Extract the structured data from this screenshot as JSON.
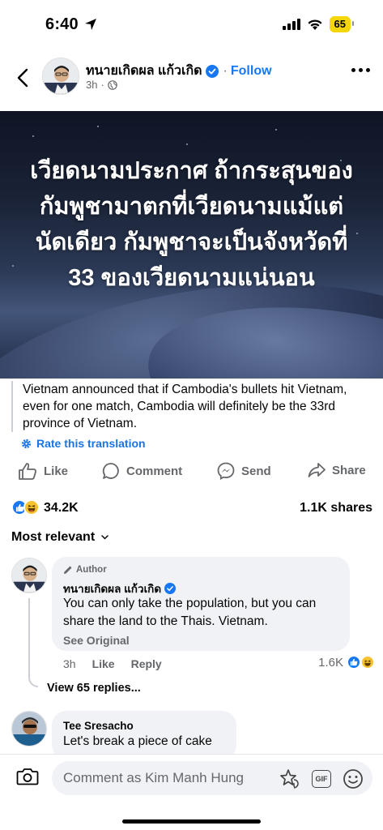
{
  "status_bar": {
    "time": "6:40",
    "battery": "65",
    "battery_color": "#f5d50b"
  },
  "post": {
    "author": "ทนายเกิดผล แก้วเกิด",
    "follow_label": "Follow",
    "time": "3h",
    "image_text": "เวียดนามประกาศ ถ้ากระสุนของกัมพูชามาตกที่เวียดนามแม้แต่นัดเดียว กัมพูชาจะเป็นจังหวัดที่ 33 ของเวียดนามแน่นอน",
    "translation": "Vietnam announced that if Cambodia's bullets hit Vietnam, even for one match, Cambodia will definitely be the 33rd province of Vietnam.",
    "rate_translation": "Rate this translation"
  },
  "actions": {
    "like": "Like",
    "comment": "Comment",
    "send": "Send",
    "share": "Share"
  },
  "counts": {
    "reactions": "34.2K",
    "shares": "1.1K shares"
  },
  "sort_label": "Most relevant",
  "comments": [
    {
      "badge": "Author",
      "name": "ทนายเกิดผล แก้วเกิด",
      "text": "You can only take the population, but you can share the land to the Thais. Vietnam.",
      "see_original": "See Original",
      "time": "3h",
      "like_label": "Like",
      "reply_label": "Reply",
      "reaction_count": "1.6K",
      "view_replies": "View 65 replies..."
    },
    {
      "name": "Tee Sresacho",
      "text": "Let's break a piece of cake"
    }
  ],
  "comment_bar": {
    "placeholder": "Comment as Kim Manh Hung",
    "gif_label": "GIF"
  },
  "colors": {
    "accent": "#1877f2",
    "link": "#1b74e4",
    "secondary_text": "#65676b",
    "bubble": "#f0f2f5"
  }
}
